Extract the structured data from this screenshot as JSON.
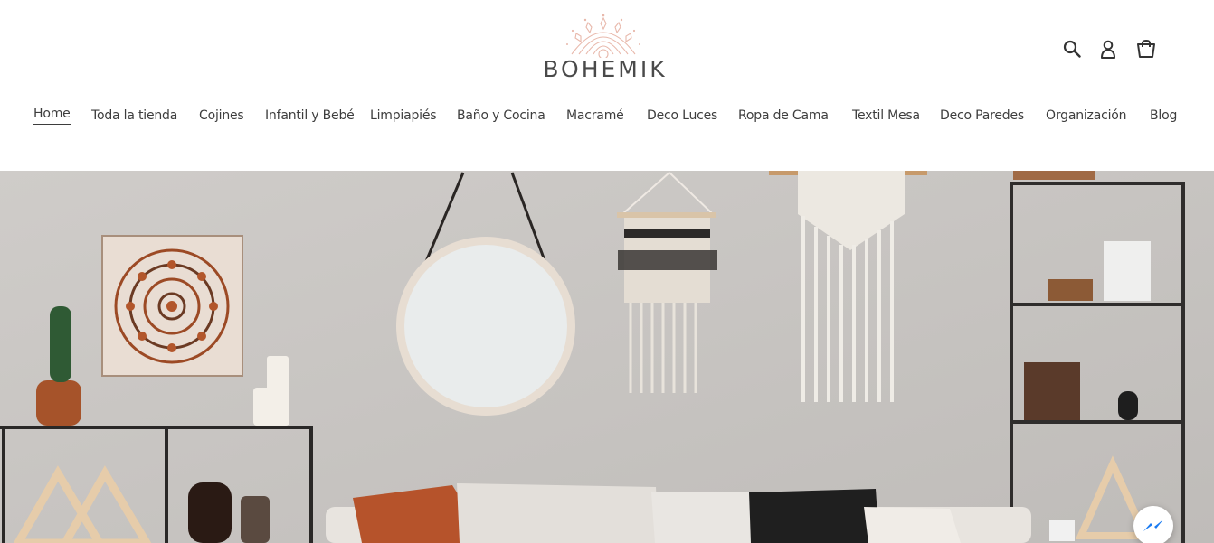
{
  "brand": {
    "name": "BOHEMIK",
    "logo_icon": "mandala-logo-icon"
  },
  "header": {
    "icons": [
      {
        "name": "search-icon",
        "label": "Buscar"
      },
      {
        "name": "account-icon",
        "label": "Ingresar"
      },
      {
        "name": "cart-icon",
        "label": "Carrito"
      }
    ]
  },
  "nav": {
    "active": "Home",
    "items": [
      {
        "label": "Home"
      },
      {
        "label": "Toda la tienda"
      },
      {
        "label": "Cojines"
      },
      {
        "label": "Infantil y Bebé"
      },
      {
        "label": "Limpiapiés"
      },
      {
        "label": "Baño y Cocina"
      },
      {
        "label": "Macramé"
      },
      {
        "label": "Deco Luces"
      },
      {
        "label": "Ropa de Cama"
      },
      {
        "label": "Textil Mesa"
      },
      {
        "label": "Deco Paredes"
      },
      {
        "label": "Organización"
      },
      {
        "label": "Blog"
      }
    ]
  },
  "hero": {
    "image": "living-room-boho-decor-photo"
  },
  "chat": {
    "icon": "messenger-icon"
  },
  "colors": {
    "accent_logo": "#e6b5a8",
    "text": "#3d3d3d",
    "wall": "#c9c6c3"
  }
}
